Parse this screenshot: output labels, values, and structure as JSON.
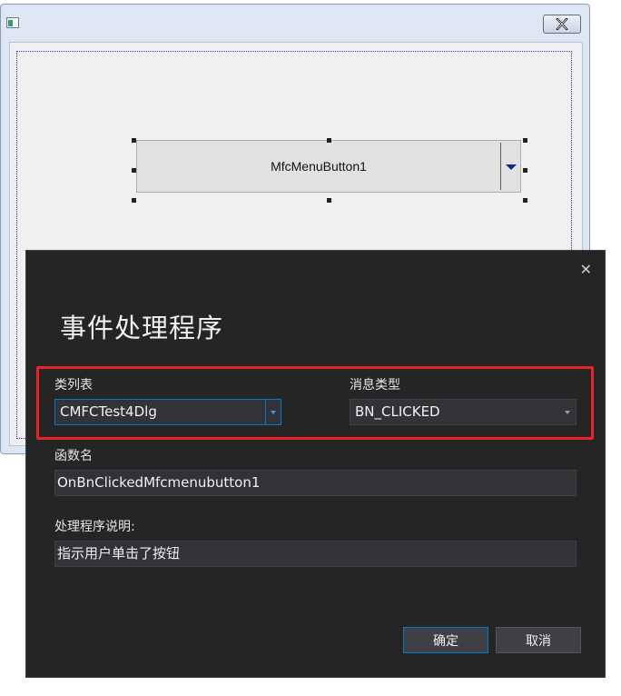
{
  "designer": {
    "menu_button_label": "MfcMenuButton1"
  },
  "dialog": {
    "title": "事件处理程序",
    "close_glyph": "✕",
    "class_list": {
      "label": "类列表",
      "value": "CMFCTest4Dlg"
    },
    "message_type": {
      "label": "消息类型",
      "value": "BN_CLICKED"
    },
    "function_name": {
      "label": "函数名",
      "value": "OnBnClickedMfcmenubutton1"
    },
    "handler_description": {
      "label": "处理程序说明:",
      "value": "指示用户单击了按钮"
    },
    "ok_label": "确定",
    "cancel_label": "取消"
  },
  "colors": {
    "dialog_bg": "#252526",
    "accent_blue": "#007acc",
    "highlight_red": "#e8232a",
    "designer_bg": "#f0f0f0"
  },
  "icons": [
    "system-menu-icon",
    "close-icon",
    "dropdown-arrow-icon"
  ]
}
